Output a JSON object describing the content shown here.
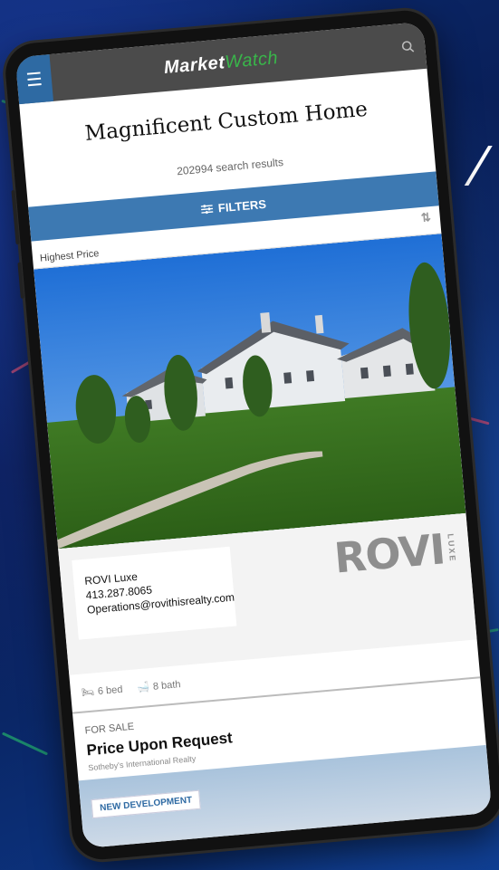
{
  "header": {
    "logo_part1": "Market",
    "logo_part2": "Watch",
    "menu_icon": "hamburger-icon",
    "search_icon": "search-icon"
  },
  "page": {
    "title": "Magnificent Custom Home",
    "results_text": "202994 search results",
    "filters_label": "FILTERS",
    "sort_label": "Highest Price"
  },
  "listing": {
    "agent": {
      "name": "ROVI Luxe",
      "phone": "413.287.8065",
      "email": "Operations@rovithisrealty.com",
      "logo_word": "ROVI",
      "logo_sub": "LUXE"
    },
    "beds": "6 bed",
    "baths": "8 bath",
    "status": "FOR SALE",
    "price": "Price Upon Request",
    "brokerage": "Sotheby's International Realty"
  },
  "next_listing": {
    "badge": "NEW DEVELOPMENT"
  },
  "colors": {
    "accent_blue": "#3d79b2",
    "header_gray": "#4b4b4b",
    "logo_green": "#39b54a"
  }
}
